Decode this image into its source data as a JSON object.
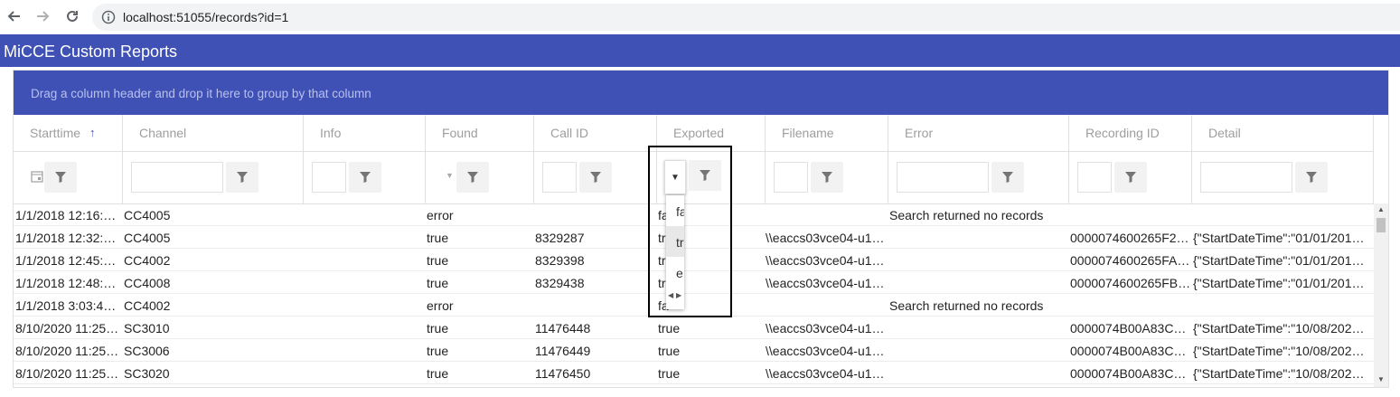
{
  "browser": {
    "url": "localhost:51055/records?id=1"
  },
  "app": {
    "title": "MiCCE Custom Reports"
  },
  "grid": {
    "group_hint": "Drag a column header and drop it here to group by that column",
    "columns": [
      "Starttime",
      "Channel",
      "Info",
      "Found",
      "Call ID",
      "Exported",
      "Filename",
      "Error",
      "Recording ID",
      "Detail"
    ],
    "sort_indicator": "↑",
    "rows": [
      [
        "1/1/2018 12:16:…",
        "CC4005",
        "",
        "error",
        "",
        "fa",
        "",
        "Search returned no records",
        "",
        ""
      ],
      [
        "1/1/2018 12:32:…",
        "CC4005",
        "",
        "true",
        "8329287",
        "tr",
        "\\\\eaccs03vce04-u1…",
        "",
        "0000074600265F2…",
        "{\"StartDateTime\":\"01/01/201…"
      ],
      [
        "1/1/2018 12:45:…",
        "CC4002",
        "",
        "true",
        "8329398",
        "tr",
        "\\\\eaccs03vce04-u1…",
        "",
        "0000074600265FA…",
        "{\"StartDateTime\":\"01/01/201…"
      ],
      [
        "1/1/2018 12:48:…",
        "CC4008",
        "",
        "true",
        "8329438",
        "tr",
        "\\\\eaccs03vce04-u1…",
        "",
        "0000074600265FB…",
        "{\"StartDateTime\":\"01/01/201…"
      ],
      [
        "1/1/2018 3:03:4…",
        "CC4002",
        "",
        "error",
        "",
        "fa",
        "",
        "Search returned no records",
        "",
        ""
      ],
      [
        "8/10/2020 11:25…",
        "SC3010",
        "",
        "true",
        "11476448",
        "true",
        "\\\\eaccs03vce04-u1…",
        "",
        "0000074B00A83C…",
        "{\"StartDateTime\":\"10/08/202…"
      ],
      [
        "8/10/2020 11:25…",
        "SC3006",
        "",
        "true",
        "11476449",
        "true",
        "\\\\eaccs03vce04-u1…",
        "",
        "0000074B00A83C…",
        "{\"StartDateTime\":\"10/08/202…"
      ],
      [
        "8/10/2020 11:25…",
        "SC3020",
        "",
        "true",
        "11476450",
        "true",
        "\\\\eaccs03vce04-u1…",
        "",
        "0000074B00A83C…",
        "{\"StartDateTime\":\"10/08/202…"
      ]
    ]
  },
  "exported_dropdown": {
    "options": [
      "fa",
      "tr",
      "e"
    ],
    "highlighted_index": 1
  },
  "colors": {
    "primary": "#3f51b5",
    "header_text": "#9e9e9e"
  }
}
